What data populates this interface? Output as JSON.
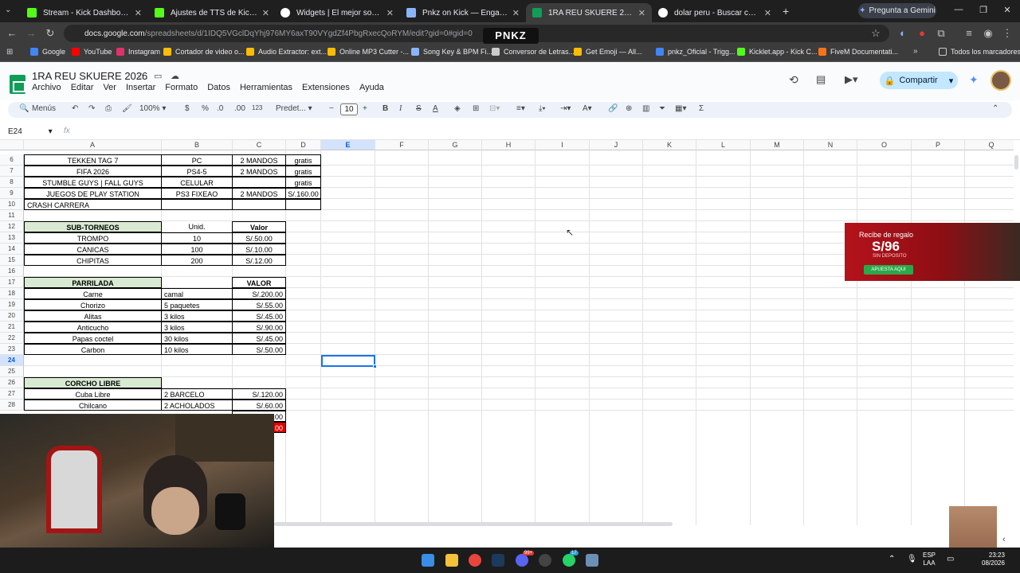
{
  "tabs": [
    {
      "title": "Stream - Kick Dashboard",
      "color": "#53fc18"
    },
    {
      "title": "Ajustes de TTS de KickBot",
      "color": "#53fc18"
    },
    {
      "title": "Widgets | El mejor software para",
      "color": "#ffffff"
    },
    {
      "title": "Pnkz on Kick — Engagement A",
      "color": "#8ab4f8"
    },
    {
      "title": "1RA REU SKUERE 2026 - Hojas",
      "color": "#0f9d58"
    },
    {
      "title": "dolar peru - Buscar con Google",
      "color": "#ffffff"
    }
  ],
  "browser": {
    "gemini": "Pregunta a Gemini",
    "url_domain": "docs.google.com",
    "url_path": "/spreadsheets/d/1IDQ5VGclDqYhj976MY6axT90VYgdZf4PbgRxecQoRYM/edit?gid=0#gid=0",
    "overlay_logo": "PNKZ"
  },
  "bookmarks": [
    {
      "label": "Google",
      "color": "#4285f4"
    },
    {
      "label": "YouTube",
      "color": "#ff0000"
    },
    {
      "label": "Instagram",
      "color": "#e1306c"
    },
    {
      "label": "Cortador de video o...",
      "color": "#fbbc04"
    },
    {
      "label": "Audio Extractor: ext...",
      "color": "#fbbc04"
    },
    {
      "label": "Online MP3 Cutter -...",
      "color": "#fbbc04"
    },
    {
      "label": "Song Key & BPM Fi...",
      "color": "#8ab4f8"
    },
    {
      "label": "Conversor de Letras...",
      "color": "#cccccc"
    },
    {
      "label": "Get Emoji — All...",
      "color": "#fbbc04"
    },
    {
      "label": "pnkz_Oficial - Trigg...",
      "color": "#4285f4"
    },
    {
      "label": "Kicklet.app - Kick C...",
      "color": "#53fc18"
    },
    {
      "label": "FiveM Documentati...",
      "color": "#f97316"
    }
  ],
  "bookmarks_all": "Todos los marcadores",
  "doc": {
    "title": "1RA REU SKUERE 2026",
    "menu": [
      "Archivo",
      "Editar",
      "Ver",
      "Insertar",
      "Formato",
      "Datos",
      "Herramientas",
      "Extensiones",
      "Ayuda"
    ],
    "share": "Compartir"
  },
  "toolbar": {
    "search": "Menús",
    "zoom": "100%",
    "currency": "$",
    "percent": "%",
    "dec_less": ".0",
    "dec_more": ".00",
    "format_123": "123",
    "font": "Predet...",
    "font_size": "10"
  },
  "formula": {
    "name_box": "E24",
    "fx": "fx"
  },
  "columns": [
    "A",
    "B",
    "C",
    "D",
    "E",
    "F",
    "G",
    "H",
    "I",
    "J",
    "K",
    "L",
    "M",
    "N",
    "O",
    "P",
    "Q"
  ],
  "rows": [
    "6",
    "7",
    "8",
    "9",
    "10",
    "11",
    "12",
    "13",
    "14",
    "15",
    "16",
    "17",
    "18",
    "19",
    "20",
    "21",
    "22",
    "23",
    "24",
    "25",
    "26",
    "27",
    "28"
  ],
  "sheet": {
    "games": [
      {
        "a": "TEKKEN TAG 7",
        "b": "PC",
        "c": "2 MANDOS",
        "d": "gratis"
      },
      {
        "a": "FIFA 2026",
        "b": "PS4-5",
        "c": "2 MANDOS",
        "d": "gratis"
      },
      {
        "a": "STUMBLE GUYS | FALL GUYS",
        "b": "CELULAR",
        "c": "",
        "d": "gratis"
      },
      {
        "a": "JUEGOS DE PLAY STATION",
        "b": "PS3 FIXEAO",
        "c": "2 MANDOS",
        "d": "S/.160.00"
      },
      {
        "a": "CRASH CARRERA",
        "b": "",
        "c": "",
        "d": ""
      }
    ],
    "subtorneos": {
      "header": {
        "a": "SUB-TORNEOS",
        "b": "Unid.",
        "c": "Valor"
      },
      "rows": [
        {
          "a": "TROMPO",
          "b": "10",
          "c": "S/.50.00"
        },
        {
          "a": "CANICAS",
          "b": "100",
          "c": "S/.10.00"
        },
        {
          "a": "CHIPITAS",
          "b": "200",
          "c": "S/.12.00"
        }
      ]
    },
    "parrilada": {
      "header": {
        "a": "PARRILADA",
        "c": "VALOR"
      },
      "rows": [
        {
          "a": "Carne",
          "b": "camal",
          "c": "S/.200.00"
        },
        {
          "a": "Chorizo",
          "b": "5 paquetes",
          "c": "S/.55.00"
        },
        {
          "a": "Alitas",
          "b": "3 kilos",
          "c": "S/.45.00"
        },
        {
          "a": "Anticucho",
          "b": "3 kilos",
          "c": "S/.90.00"
        },
        {
          "a": "Papas coctel",
          "b": "30 kilos",
          "c": "S/.45.00"
        },
        {
          "a": "Carbon",
          "b": "10 kilos",
          "c": "S/.50.00"
        }
      ]
    },
    "corcho": {
      "header": "CORCHO LIBRE",
      "rows": [
        {
          "a": "Cuba Libre",
          "b": "2 BARCELO",
          "c": "S/.120.00"
        },
        {
          "a": "Chilcano",
          "b": "2 ACHOLADOS",
          "c": "S/.60.00"
        }
      ],
      "partial": [
        ".00",
        ".00"
      ]
    }
  },
  "ad": {
    "line1": "Recibe de regalo",
    "amount": "S/96",
    "line2": "SIN DEPOSITO",
    "button": "APUESTA AQUI"
  },
  "stream_overlay": "X6",
  "taskbar": {
    "lang1": "ESP",
    "lang2": "LAA",
    "time": "23:23",
    "date": "08/2026",
    "badge1": "99+",
    "badge2": "17"
  }
}
